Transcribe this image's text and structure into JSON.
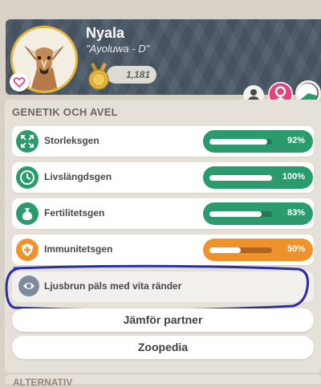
{
  "animal": {
    "name": "Nyala",
    "nickname": "\"Ayoluwa - D\"",
    "points": "1,181",
    "portrait_icon": "nyala-portrait",
    "favorite_icon": "heart-icon"
  },
  "header_buttons": {
    "profile_icon": "person-icon",
    "gender_icon": "female-symbol-icon",
    "age_icon": "pie-progress-icon",
    "gender_color": "#e0457b"
  },
  "genetics": {
    "title": "GENETIK OCH AVEL",
    "genes": [
      {
        "label": "Storleksgen",
        "value": "92%",
        "fraction": 0.92,
        "icon": "expand-arrows-icon",
        "color": "green"
      },
      {
        "label": "Livslängdsgen",
        "value": "100%",
        "fraction": 1.0,
        "icon": "clock-icon",
        "color": "green"
      },
      {
        "label": "Fertilitetsgen",
        "value": "83%",
        "fraction": 0.83,
        "icon": "fertility-sack-icon",
        "color": "green"
      },
      {
        "label": "Immunitetsgen",
        "value": "50%",
        "fraction": 0.5,
        "icon": "shield-cross-icon",
        "color": "orange"
      }
    ],
    "trait": {
      "label": "Ljusbrun päls med vita ränder",
      "icon": "coat-pattern-icon"
    }
  },
  "actions": {
    "compare_partner": "Jämför partner",
    "zoopedia": "Zoopedia"
  },
  "next_section": {
    "title": "ALTERNATIV"
  },
  "colors": {
    "green": "#2b9a6c",
    "orange": "#f0922c",
    "header": "#4a5866",
    "annotation": "#2a2fa6"
  }
}
